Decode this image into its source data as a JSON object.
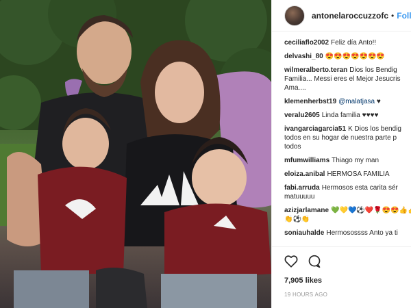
{
  "post": {
    "username": "antonelaroccuzzofc",
    "separator": "•",
    "follow_label": "Follow"
  },
  "comments": [
    {
      "user": "ceciliaflo2002",
      "lines": [
        "Feliz día Anto!!"
      ]
    },
    {
      "user": "delvashi_80",
      "lines": [
        "😍😍😍😍😍😍😍"
      ]
    },
    {
      "user": "wilmeralberto.teran",
      "lines": [
        "Dios los Bendig",
        "Familia... Messi eres el Mejor Jesucris",
        "Ama...."
      ]
    },
    {
      "user": "klemenherbst19",
      "mention": "@malatjasa",
      "lines": [
        "♥"
      ]
    },
    {
      "user": "veralu2605",
      "lines": [
        "Linda familia ♥♥♥♥"
      ]
    },
    {
      "user": "ivangarciagarcia51",
      "lines": [
        "K Dios los bendig",
        "todos en su hogar de nuestra parte p",
        "todos"
      ]
    },
    {
      "user": "mfumwilliams",
      "lines": [
        "Thiago my man"
      ]
    },
    {
      "user": "eloiza.anibal",
      "lines": [
        "HERMOSA FAMILIA"
      ]
    },
    {
      "user": "fabi.arruda",
      "lines": [
        "Hermosos esta carita sér",
        "matuuuuu"
      ]
    },
    {
      "user": "azizjarlamane",
      "lines": [
        "💚💛💙⚽️❤️🌹😍😍👍👍",
        "👏⚽️👏"
      ]
    },
    {
      "user": "soniauhalde",
      "lines": [
        "Hermosossss Anto ya ti"
      ]
    }
  ],
  "likes": "7,905 likes",
  "time": "19 HOURS AGO",
  "icons": {
    "like": "heart-icon",
    "comment": "comment-icon"
  }
}
